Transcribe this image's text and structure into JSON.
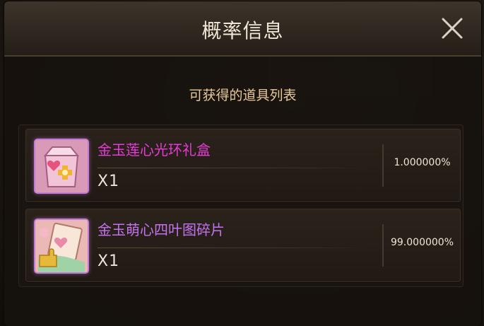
{
  "dialog": {
    "title": "概率信息",
    "subtitle": "可获得的道具列表"
  },
  "items": [
    {
      "name": "金玉莲心光环礼盒",
      "quantity": "X1",
      "probability": "1.000000%",
      "name_color": "#e63bd8",
      "icon": "gift-bag-icon"
    },
    {
      "name": "金玉萌心四叶图碎片",
      "quantity": "X1",
      "probability": "99.000000%",
      "name_color": "#c472f0",
      "icon": "puzzle-fragment-icon"
    }
  ],
  "colors": {
    "accent_subtitle": "#e6c79a",
    "rarity_frame": "#c37bd6"
  }
}
